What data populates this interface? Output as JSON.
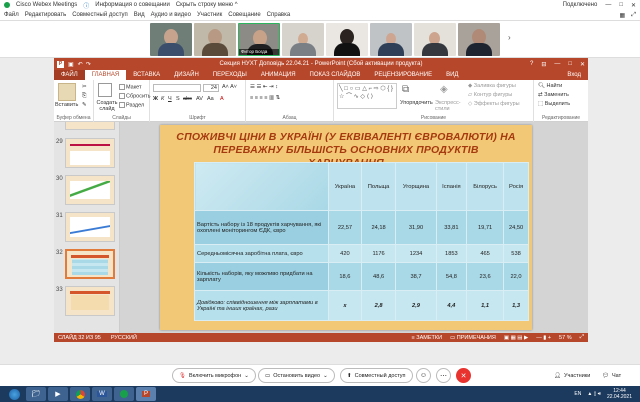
{
  "webex": {
    "app_title": "Cisco Webex Meetings",
    "info_label": "Информация о совещании",
    "hide_menu": "Скрыть строку меню ^",
    "connected": "Подключено",
    "menu": [
      "Файл",
      "Редактировать",
      "Совместный доступ",
      "Вид",
      "Аудио и видео",
      "Участник",
      "Совещание",
      "Справка"
    ],
    "active_speaker": "Фитор Богда",
    "controls": {
      "mic": "Включить микрофон",
      "video": "Остановить видео",
      "share": "Совместный доступ",
      "participants": "Участники",
      "chat": "Чат"
    }
  },
  "ppt": {
    "window_title": "Секция НУХТ Доповідь 22.04.21 - PowerPoint (Сбой активации продукта)",
    "tabs": [
      "ФАЙЛ",
      "ГЛАВНАЯ",
      "ВСТАВКА",
      "ДИЗАЙН",
      "ПЕРЕХОДЫ",
      "АНИМАЦИЯ",
      "ПОКАЗ СЛАЙДОВ",
      "РЕЦЕНЗИРОВАНИЕ",
      "ВИД"
    ],
    "login": "Вход",
    "ribbon": {
      "paste": "Вставить",
      "new_slide": "Создать слайд",
      "layout": "Макет",
      "reset": "Сбросить",
      "section": "Раздел",
      "arrange": "Упорядочить",
      "express": "Экспресс-стили",
      "fill": "Заливка фигуры",
      "outline": "Контур фигуры",
      "effects": "Эффекты фигуры",
      "find": "Найти",
      "replace": "Заменить",
      "select": "Выделить",
      "font_size": "24",
      "groups": [
        "Буфер обмена",
        "Слайды",
        "Шрифт",
        "Абзац",
        "Рисование",
        "Редактирование"
      ]
    },
    "slide_numbers": [
      "29",
      "30",
      "31",
      "32",
      "33"
    ],
    "status": {
      "slide": "СЛАЙД 32 ИЗ 95",
      "lang": "РУССКИЙ",
      "notes": "ЗАМЕТКИ",
      "comments": "ПРИМЕЧАНИЯ",
      "zoom": "57 %"
    }
  },
  "slide": {
    "title": "СПОЖИВЧІ ЦІНИ В УКРАЇНІ (У ЕКВІВАЛЕНТІ ЄВРОВАЛЮТИ) НА ПЕРЕВАЖНУ БІЛЬШІСТЬ ОСНОВНИХ ПРОДУКТІВ ХАРЧУВАННЯ",
    "columns": [
      "Україна",
      "Польща",
      "Угорщина",
      "Іспанія",
      "Білорусь",
      "Росія"
    ],
    "rows": [
      {
        "label": "Вартість набору із 18 продуктів харчування, які охоплені моніторингом ЄДК, євро",
        "values": [
          "22,57",
          "24,18",
          "31,90",
          "33,81",
          "19,71",
          "24,50"
        ]
      },
      {
        "label": "Середньомісячна заробітна плата, євро",
        "values": [
          "420",
          "1176",
          "1234",
          "1853",
          "465",
          "538"
        ]
      },
      {
        "label": "Кількість наборів, яку можливо придбати на зарплату",
        "values": [
          "18,6",
          "48,6",
          "38,7",
          "54,8",
          "23,6",
          "22,0"
        ]
      },
      {
        "label": "Довідково: співвідношення між зарплатами в Україні та інших країнах, рази",
        "values": [
          "x",
          "2,8",
          "2,9",
          "4,4",
          "1,1",
          "1,3"
        ]
      }
    ]
  },
  "taskbar": {
    "lang": "EN",
    "time": "12:44",
    "date": "22.04.2021"
  },
  "colors": {
    "ppt_accent": "#b7472a",
    "slide_bg": "#f2c877",
    "title_color": "#a63a0f",
    "end_call": "#e8332e"
  }
}
